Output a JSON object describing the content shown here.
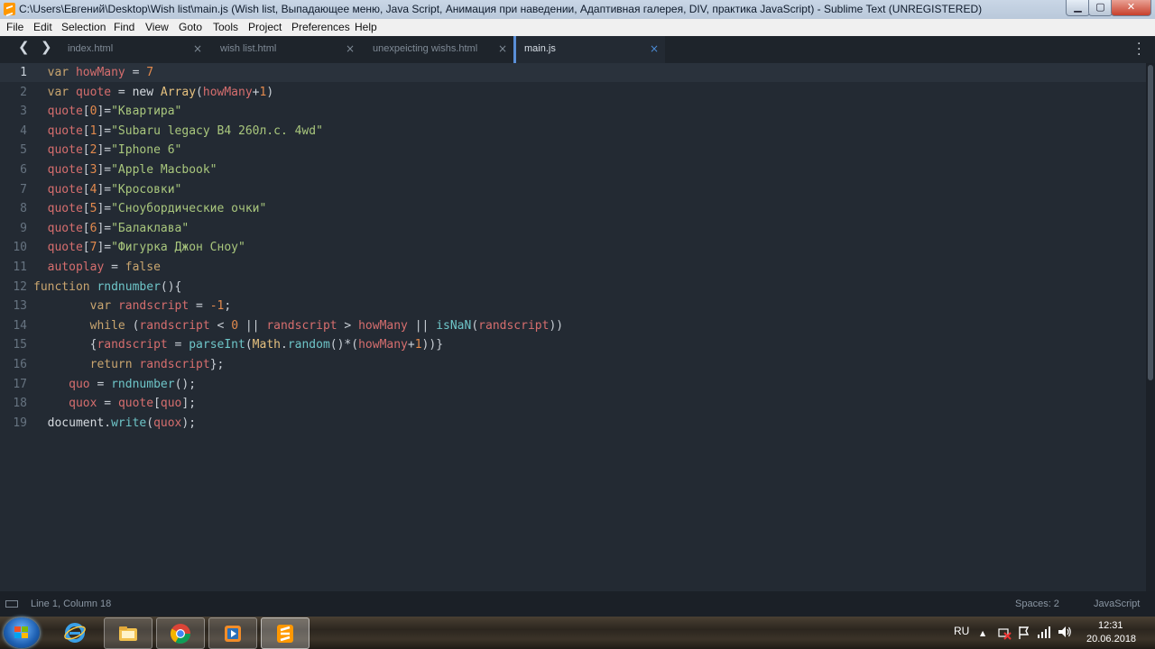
{
  "window": {
    "title": "C:\\Users\\Евгений\\Desktop\\Wish list\\main.js (Wish list, Выпадающее меню, Java Script, Анимация при наведении, Адаптивная галерея, DIV, практика JavaScript) - Sublime Text (UNREGISTERED)",
    "minimize_glyph": "▁",
    "maximize_glyph": "▢",
    "close_glyph": "✕"
  },
  "menu": [
    "File",
    "Edit",
    "Selection",
    "Find",
    "View",
    "Goto",
    "Tools",
    "Project",
    "Preferences",
    "Help"
  ],
  "nav": {
    "back": "❮",
    "forward": "❯"
  },
  "tabs": [
    {
      "label": "index.html",
      "close": "×",
      "active": false
    },
    {
      "label": "wish list.html",
      "close": "×",
      "active": false
    },
    {
      "label": "unexpeicting wishs.html",
      "close": "×",
      "active": false
    },
    {
      "label": "main.js",
      "close": "×",
      "active": true
    }
  ],
  "editor": {
    "line_numbers": [
      "1",
      "2",
      "3",
      "4",
      "5",
      "6",
      "7",
      "8",
      "9",
      "10",
      "11",
      "12",
      "13",
      "14",
      "15",
      "16",
      "17",
      "18",
      "19"
    ],
    "lines": [
      [
        [
          "  ",
          "p"
        ],
        [
          "var",
          "kw"
        ],
        [
          " ",
          "p"
        ],
        [
          "howMany",
          "v"
        ],
        [
          " = ",
          "p"
        ],
        [
          "7",
          "n"
        ]
      ],
      [
        [
          "  ",
          "p"
        ],
        [
          "var",
          "kw"
        ],
        [
          " ",
          "p"
        ],
        [
          "quote",
          "v"
        ],
        [
          " = ",
          "p"
        ],
        [
          "new",
          "w"
        ],
        [
          " ",
          "p"
        ],
        [
          "Array",
          "c"
        ],
        [
          "(",
          "p"
        ],
        [
          "howMany",
          "v"
        ],
        [
          "+",
          "p"
        ],
        [
          "1",
          "n"
        ],
        [
          ")",
          "p"
        ]
      ],
      [
        [
          "  ",
          "p"
        ],
        [
          "quote",
          "v"
        ],
        [
          "[",
          "p"
        ],
        [
          "0",
          "n"
        ],
        [
          "]=",
          "p"
        ],
        [
          "\"Квартира\"",
          "s"
        ]
      ],
      [
        [
          "  ",
          "p"
        ],
        [
          "quote",
          "v"
        ],
        [
          "[",
          "p"
        ],
        [
          "1",
          "n"
        ],
        [
          "]=",
          "p"
        ],
        [
          "\"Subaru legacy B4 260л.с. 4wd\"",
          "s"
        ]
      ],
      [
        [
          "  ",
          "p"
        ],
        [
          "quote",
          "v"
        ],
        [
          "[",
          "p"
        ],
        [
          "2",
          "n"
        ],
        [
          "]=",
          "p"
        ],
        [
          "\"Iphone 6\"",
          "s"
        ]
      ],
      [
        [
          "  ",
          "p"
        ],
        [
          "quote",
          "v"
        ],
        [
          "[",
          "p"
        ],
        [
          "3",
          "n"
        ],
        [
          "]=",
          "p"
        ],
        [
          "\"Apple Macbook\"",
          "s"
        ]
      ],
      [
        [
          "  ",
          "p"
        ],
        [
          "quote",
          "v"
        ],
        [
          "[",
          "p"
        ],
        [
          "4",
          "n"
        ],
        [
          "]=",
          "p"
        ],
        [
          "\"Кросовки\"",
          "s"
        ]
      ],
      [
        [
          "  ",
          "p"
        ],
        [
          "quote",
          "v"
        ],
        [
          "[",
          "p"
        ],
        [
          "5",
          "n"
        ],
        [
          "]=",
          "p"
        ],
        [
          "\"Сноубордические очки\"",
          "s"
        ]
      ],
      [
        [
          "  ",
          "p"
        ],
        [
          "quote",
          "v"
        ],
        [
          "[",
          "p"
        ],
        [
          "6",
          "n"
        ],
        [
          "]=",
          "p"
        ],
        [
          "\"Балаклава\"",
          "s"
        ]
      ],
      [
        [
          "  ",
          "p"
        ],
        [
          "quote",
          "v"
        ],
        [
          "[",
          "p"
        ],
        [
          "7",
          "n"
        ],
        [
          "]=",
          "p"
        ],
        [
          "\"Фигурка Джон Сноу\"",
          "s"
        ]
      ],
      [
        [
          "  ",
          "p"
        ],
        [
          "autoplay",
          "v"
        ],
        [
          " = ",
          "p"
        ],
        [
          "false",
          "kw"
        ]
      ],
      [
        [
          "function",
          "kw"
        ],
        [
          " ",
          "p"
        ],
        [
          "rndnumber",
          "f"
        ],
        [
          "(){",
          "p"
        ]
      ],
      [
        [
          "        ",
          "p"
        ],
        [
          "var",
          "kw"
        ],
        [
          " ",
          "p"
        ],
        [
          "randscript",
          "v"
        ],
        [
          " = ",
          "p"
        ],
        [
          "-1",
          "n"
        ],
        [
          ";",
          "p"
        ]
      ],
      [
        [
          "        ",
          "p"
        ],
        [
          "while",
          "kw"
        ],
        [
          " (",
          "p"
        ],
        [
          "randscript",
          "v"
        ],
        [
          " < ",
          "p"
        ],
        [
          "0",
          "n"
        ],
        [
          " || ",
          "p"
        ],
        [
          "randscript",
          "v"
        ],
        [
          " > ",
          "p"
        ],
        [
          "howMany",
          "v"
        ],
        [
          " || ",
          "p"
        ],
        [
          "isNaN",
          "f"
        ],
        [
          "(",
          "p"
        ],
        [
          "randscript",
          "v"
        ],
        [
          "))",
          "p"
        ]
      ],
      [
        [
          "        ",
          "p"
        ],
        [
          "{",
          "p"
        ],
        [
          "randscript",
          "v"
        ],
        [
          " = ",
          "p"
        ],
        [
          "parseInt",
          "f"
        ],
        [
          "(",
          "p"
        ],
        [
          "Math",
          "c"
        ],
        [
          ".",
          "p"
        ],
        [
          "random",
          "f"
        ],
        [
          "()*(",
          "p"
        ],
        [
          "howMany",
          "v"
        ],
        [
          "+",
          "p"
        ],
        [
          "1",
          "n"
        ],
        [
          "))}",
          "p"
        ]
      ],
      [
        [
          "        ",
          "p"
        ],
        [
          "return",
          "kw"
        ],
        [
          " ",
          "p"
        ],
        [
          "randscript",
          "v"
        ],
        [
          "};",
          "p"
        ]
      ],
      [
        [
          "     ",
          "p"
        ],
        [
          "quo",
          "v"
        ],
        [
          " = ",
          "p"
        ],
        [
          "rndnumber",
          "f"
        ],
        [
          "();",
          "p"
        ]
      ],
      [
        [
          "     ",
          "p"
        ],
        [
          "quox",
          "v"
        ],
        [
          " = ",
          "p"
        ],
        [
          "quote",
          "v"
        ],
        [
          "[",
          "p"
        ],
        [
          "quo",
          "v"
        ],
        [
          "];",
          "p"
        ]
      ],
      [
        [
          "  ",
          "p"
        ],
        [
          "document",
          "w"
        ],
        [
          ".",
          "p"
        ],
        [
          "write",
          "f"
        ],
        [
          "(",
          "p"
        ],
        [
          "quox",
          "v"
        ],
        [
          ");",
          "p"
        ]
      ]
    ]
  },
  "status": {
    "position": "Line 1, Column 18",
    "indent": "Spaces: 2",
    "syntax": "JavaScript"
  },
  "taskbar": {
    "apps": [
      "start-button",
      "internet-explorer",
      "file-explorer",
      "google-chrome",
      "media-player",
      "sublime-text"
    ],
    "language": "RU",
    "time": "12:31",
    "date": "20.06.2018",
    "tray_up": "▲",
    "tray_volume": "🔊"
  }
}
